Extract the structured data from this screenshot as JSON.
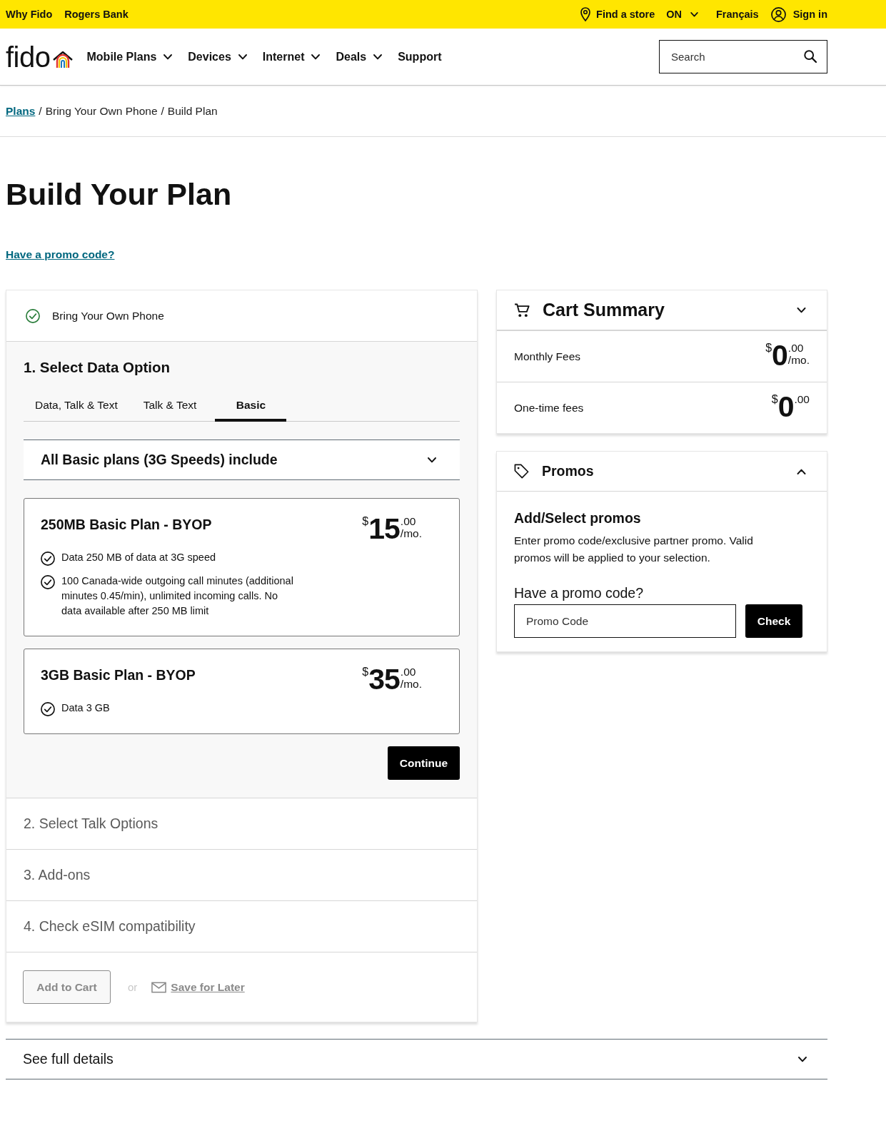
{
  "top_bar": {
    "links": [
      "Why Fido",
      "Rogers Bank"
    ],
    "find_store": "Find a store",
    "province": "ON",
    "language": "Français",
    "sign_in": "Sign in"
  },
  "header": {
    "logo": "fido",
    "nav": [
      {
        "label": "Mobile Plans",
        "menu": true
      },
      {
        "label": "Devices",
        "menu": true
      },
      {
        "label": "Internet",
        "menu": true
      },
      {
        "label": "Deals",
        "menu": true
      },
      {
        "label": "Support",
        "menu": false
      }
    ],
    "search": {
      "placeholder": "Search"
    }
  },
  "breadcrumb": [
    {
      "kind": "link",
      "label": "Plans"
    },
    {
      "kind": "separator",
      "label": "/"
    },
    {
      "kind": "text",
      "label": "Bring Your Own Phone"
    },
    {
      "kind": "separator",
      "label": "/"
    },
    {
      "kind": "text",
      "label": "Build Plan"
    }
  ],
  "title": "Build Your Plan",
  "promo_link": "Have a promo code?",
  "builder": {
    "device_step": {
      "label": "Bring Your Own Phone",
      "done": true
    },
    "active_step": {
      "title": "1. Select Data Option",
      "tabs": [
        {
          "label": "Data, Talk & Text",
          "selected": false
        },
        {
          "label": "Talk & Text",
          "selected": false
        },
        {
          "label": "Basic",
          "selected": true
        }
      ],
      "include_accordion": {
        "label": "All Basic plans (3G Speeds) include",
        "expanded": false
      },
      "plans": [
        {
          "name": "250MB Basic Plan - BYOP",
          "price": {
            "currency": "$",
            "dollars": "15",
            "cents": ".00",
            "period": "/mo."
          },
          "features": [
            "Data 250 MB of data at 3G speed",
            "100 Canada-wide outgoing call minutes (additional minutes 0.45/min), unlimited incoming calls. No data available after 250 MB limit"
          ]
        },
        {
          "name": "3GB Basic Plan - BYOP",
          "price": {
            "currency": "$",
            "dollars": "35",
            "cents": ".00",
            "period": "/mo."
          },
          "features": [
            "Data 3 GB"
          ]
        }
      ],
      "continue": "Continue"
    },
    "later_steps": [
      "2. Select Talk Options",
      "3. Add-ons",
      "4. Check eSIM compatibility"
    ],
    "actions": {
      "add_to_cart": {
        "label": "Add to Cart",
        "disabled": true
      },
      "or": "or",
      "save_for_later": {
        "label": "Save for Later",
        "disabled": true
      }
    }
  },
  "cart_summary": {
    "title": "Cart Summary",
    "fees": [
      {
        "label": "Monthly Fees",
        "price": {
          "currency": "$",
          "dollars": "0",
          "cents": ".00",
          "period": "/mo."
        }
      },
      {
        "label": "One-time fees",
        "price": {
          "currency": "$",
          "dollars": "0",
          "cents": ".00"
        }
      }
    ]
  },
  "promos": {
    "title": "Promos",
    "expanded": true,
    "heading": "Add/Select promos",
    "text": "Enter promo code/exclusive partner promo. Valid promos will be applied to your selection.",
    "code_label": "Have a promo code?",
    "code_field": {
      "placeholder": "Promo Code"
    },
    "check": "Check"
  },
  "full_details": {
    "label": "See full details",
    "expanded": false
  }
}
